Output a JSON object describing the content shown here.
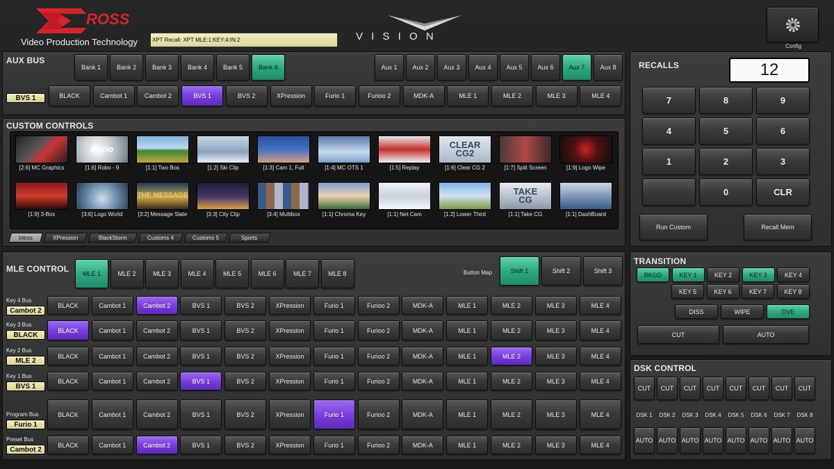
{
  "header": {
    "brand": "ROSS",
    "tagline": "Video Production Technology",
    "xpt_status": "XPT Recall: XPT MLE:1:KEY:4:IN:2",
    "product": "V I S I O N",
    "config_label": "Config"
  },
  "aux_bus": {
    "title": "AUX BUS",
    "banks": [
      "Bank 1",
      "Bank 2",
      "Bank 3",
      "Bank 4",
      "Bank 5",
      "Bank 6"
    ],
    "active_bank": "Bank 6",
    "aux": [
      "Aux 1",
      "Aux 2",
      "Aux 3",
      "Aux 4",
      "Aux 5",
      "Aux 6",
      "Aux 7",
      "Aux 8"
    ],
    "active_aux": "Aux 7",
    "bus_value": "BVS 1",
    "sources": [
      "BLACK",
      "Cambot 1",
      "Cambot 2",
      "BVS 1",
      "BVS 2",
      "XPression",
      "Furio 1",
      "Furioo 2",
      "MDK-A",
      "MLE 1",
      "MLE 2",
      "MLE 3",
      "MLE 4"
    ],
    "selected": "BVS 1"
  },
  "custom_controls": {
    "title": "CUSTOM CONTROLS",
    "row1": [
      "[2:6] MC Graphics",
      "[1:6] Robo - 9",
      "[1:1] Two Box",
      "[1:2] Ski Clip",
      "[1:3] Cam 1, Full",
      "[1:4] MC OTS 1",
      "[1:5] Replay",
      "[1:6] Clear CG 2",
      "[1:7] Split Screen",
      "[1:9] Logo Wipe"
    ],
    "row2": [
      "[1:9] 3-Box",
      "[3:6] Logo World",
      "[3:2] Message Slate",
      "[3:3] City Clip",
      "[3:4] Multibox",
      "[1:1] Chroma Key",
      "[1:1] Net Cam",
      "[1:2] Lower Third",
      "[1:1] Take CG",
      "[1:1] DashBoard"
    ],
    "thumb_text": {
      "furio": "Furio",
      "clear": "CLEAR\nCG2",
      "take": "TAKE\nCG",
      "message": "THE MESSAGE"
    },
    "tabs": [
      "Intros",
      "XPression",
      "BlackStorm",
      "Customs 4",
      "Customs 5",
      "Sports"
    ],
    "active_tab": "Intros"
  },
  "recalls": {
    "title": "RECALLS",
    "display": "12",
    "keys": [
      "7",
      "8",
      "9",
      "4",
      "5",
      "6",
      "1",
      "2",
      "3",
      "",
      "0",
      "CLR"
    ],
    "run_custom": "Run Custom",
    "recall_mem": "Recall Mem"
  },
  "mle_control": {
    "title": "MLE CONTROL",
    "mles": [
      "MLE 1",
      "MLE 2",
      "MLE 3",
      "MLE 4",
      "MLE 5",
      "MLE 6",
      "MLE 7",
      "MLE 8"
    ],
    "active_mle": "MLE 1",
    "button_map_label": "Button Map",
    "shifts": [
      "Shift 1",
      "Shift 2",
      "Shift 3"
    ],
    "active_shift": "Shift 1",
    "buses": [
      {
        "label": "Key 4 Bus",
        "value": "Cambot 2",
        "selected": 2,
        "sources": [
          "BLACK",
          "Cambot 1",
          "Cambot 2",
          "BVS 1",
          "BVS 2",
          "XPression",
          "Furio 1",
          "Furioo 2",
          "MDK-A",
          "MLE 1",
          "MLE 2",
          "MLE 3",
          "MLE 4"
        ]
      },
      {
        "label": "Key 3 Bus",
        "value": "BLACK",
        "selected": 0,
        "sources": [
          "BLACK",
          "Cambot 1",
          "Cambot 2",
          "BVS 1",
          "BVS 2",
          "XPression",
          "Furio 1",
          "Furioo 2",
          "MDK-A",
          "MLE 1",
          "MLE 2",
          "MLE 3",
          "MLE 4"
        ]
      },
      {
        "label": "Key 2 Bus",
        "value": "MLE 2",
        "selected": 10,
        "sources": [
          "BLACK",
          "Cambot 1",
          "Cambot 2",
          "BVS 1",
          "BVS 2",
          "XPression",
          "Furio 1",
          "Furioo 2",
          "MDK-A",
          "MLE 1",
          "MLE 2",
          "MLE 3",
          "MLE 4"
        ]
      },
      {
        "label": "Key 1 Bus",
        "value": "BVS 1",
        "selected": 3,
        "sources": [
          "BLACK",
          "Cambot 1",
          "Cambot 2",
          "BVS 1",
          "BVS 2",
          "XPression",
          "Furio 1",
          "Furioo 2",
          "MDK-A",
          "MLE 1",
          "MLE 2",
          "MLE 3",
          "MLE 4"
        ]
      },
      {
        "label": "Program Bus",
        "value": "Furio 1",
        "selected": 6,
        "sources": [
          "BLACK",
          "Cambot 1",
          "Cambot 2",
          "BVS 1",
          "BVS 2",
          "XPression",
          "Furio 1",
          "Furioo 2",
          "MDK-A",
          "MLE 1",
          "MLE 2",
          "MLE 3",
          "MLE 4"
        ]
      },
      {
        "label": "Preset Bus",
        "value": "Cambot 2",
        "selected": 2,
        "sources": [
          "BLACK",
          "Cambot 1",
          "Cambot 2",
          "BVS 1",
          "BVS 2",
          "XPression",
          "Furio 1",
          "Furioo 2",
          "MDK-A",
          "MLE 1",
          "MLE 2",
          "MLE 3",
          "MLE 4"
        ]
      }
    ]
  },
  "transition": {
    "title": "TRANSITION",
    "row1": [
      "BKGD",
      "KEY 1",
      "KEY 2",
      "KEY 3",
      "KEY 4"
    ],
    "row1_active": [
      "BKGD",
      "KEY 1",
      "KEY 3"
    ],
    "row2": [
      "KEY 5",
      "KEY 6",
      "KEY 7",
      "KEY 8"
    ],
    "types": [
      "DISS",
      "WIPE",
      "DVE"
    ],
    "active_type": "DVE",
    "cut": "CUT",
    "auto": "AUTO"
  },
  "dsk": {
    "title": "DSK CONTROL",
    "cut_label": "CUT",
    "auto_label": "AUTO",
    "labels": [
      "DSK 1",
      "DSK 2",
      "DSK 3",
      "DSK 4",
      "DSK 5",
      "DSK 6",
      "DSK 7",
      "DSK 8"
    ]
  },
  "colors": {
    "green": "#2fa882",
    "purple": "#7a3fdc",
    "brand_red": "#d8232a",
    "bus_tag": "#e6e0a4"
  }
}
